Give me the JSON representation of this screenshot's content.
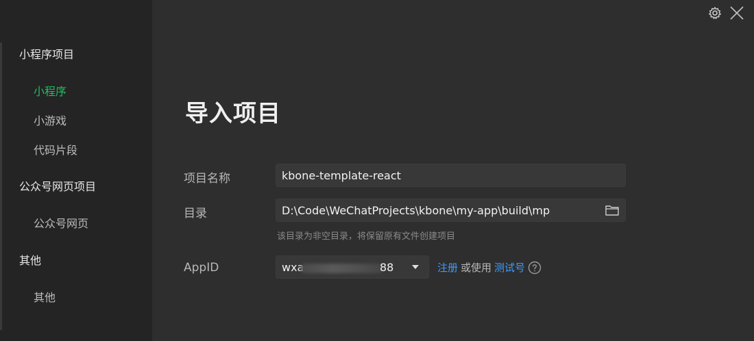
{
  "sidebar": {
    "groups": [
      {
        "title": "小程序项目",
        "items": [
          "小程序",
          "小游戏",
          "代码片段"
        ]
      },
      {
        "title": "公众号网页项目",
        "items": [
          "公众号网页"
        ]
      },
      {
        "title": "其他",
        "items": [
          "其他"
        ]
      }
    ]
  },
  "topbar": {
    "icons": [
      "gear-icon",
      "close-icon"
    ]
  },
  "main": {
    "title": "导入项目",
    "project_name": {
      "label": "项目名称",
      "value": "kbone-template-react"
    },
    "directory": {
      "label": "目录",
      "value": "D:\\Code\\WeChatProjects\\kbone\\my-app\\build\\mp",
      "hint": "该目录为非空目录，将保留原有文件创建项目"
    },
    "appid": {
      "label": "AppID",
      "prefix": "wxa",
      "suffix": "88",
      "register": "注册",
      "or_use": "或使用",
      "test_account": "测试号"
    }
  },
  "colors": {
    "accent": "#1fbf5f",
    "link": "#3e9bff",
    "sidebar_bg": "#242424",
    "main_bg": "#2e2e2e"
  }
}
